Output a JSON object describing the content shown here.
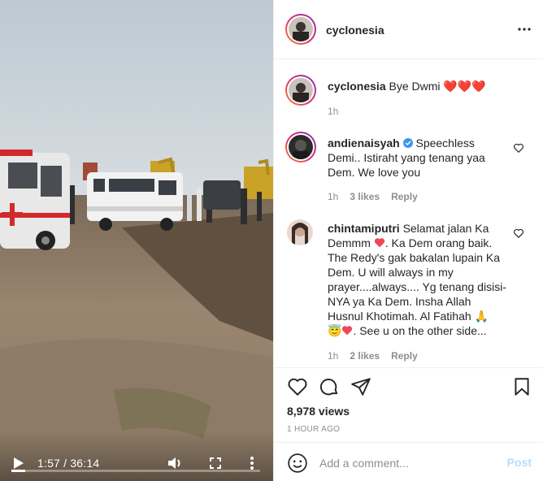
{
  "video": {
    "time": "1:57 / 36:14",
    "progress_fraction": 0.054
  },
  "post": {
    "author": "cyclonesia",
    "caption": {
      "username": "cyclonesia",
      "text": "Bye Dwmi",
      "emoji": "❤️❤️❤️",
      "time": "1h"
    },
    "comments": [
      {
        "username": "andienaisyah",
        "verified": true,
        "lines": [
          "Speechless",
          "Demi.. Istiraht yang tenang yaa",
          "Dem. We love you"
        ],
        "time": "1h",
        "likes": "3 likes",
        "reply": "Reply"
      },
      {
        "username": "chintamiputri",
        "lines": [
          "Selamat jalan Ka",
          "Demmm",
          ". Ka Dem orang baik.",
          "The Redy's gak bakalan lupain Ka",
          "Dem. U will always in my",
          "prayer....always.... Yg tenang disisi-",
          "NYA ya Ka Dem. Insha Allah",
          "Husnul Khotimah. Al Fatihah",
          ". See u on the other side..."
        ],
        "time": "1h",
        "likes": "2 likes",
        "reply": "Reply"
      }
    ],
    "views": "8,978 views",
    "ago": "1 HOUR AGO"
  },
  "add_comment": {
    "placeholder": "Add a comment...",
    "post_label": "Post"
  },
  "icons": {
    "like": "heart-icon",
    "comment": "comment-icon",
    "share": "paper-plane-icon",
    "save": "bookmark-icon",
    "emoji": "smiley-icon",
    "verified": "verified-badge-icon"
  },
  "colors": {
    "heart_red": "#ed4956",
    "verified_blue": "#3897f0",
    "post_button_disabled": "#b2dffc",
    "muted_text": "#8e8e8e"
  }
}
